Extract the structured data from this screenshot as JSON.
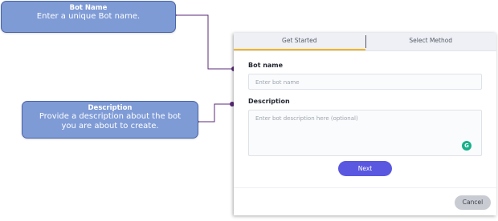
{
  "callouts": {
    "bot_name": {
      "title": "Bot Name",
      "text": "Enter a unique Bot name."
    },
    "description": {
      "title": "Description",
      "line1": "Provide a description about the bot",
      "line2": "you are about to create."
    }
  },
  "modal": {
    "tabs": [
      {
        "label": "Get Started",
        "active": true
      },
      {
        "label": "Select Method",
        "active": false
      }
    ],
    "bot_name_label": "Bot name",
    "bot_name_placeholder": "Enter bot name",
    "description_label": "Description",
    "description_placeholder": "Enter bot description here (optional)",
    "next_label": "Next",
    "cancel_label": "Cancel"
  },
  "colors": {
    "callout_fill": "#7e9bd6",
    "connector": "#5b2a7a",
    "active_tab_underline": "#f0b429",
    "primary_button": "#5a58e0",
    "cancel_button": "#c9cbd3"
  },
  "icons": {
    "grammarly": "grammarly-icon"
  }
}
